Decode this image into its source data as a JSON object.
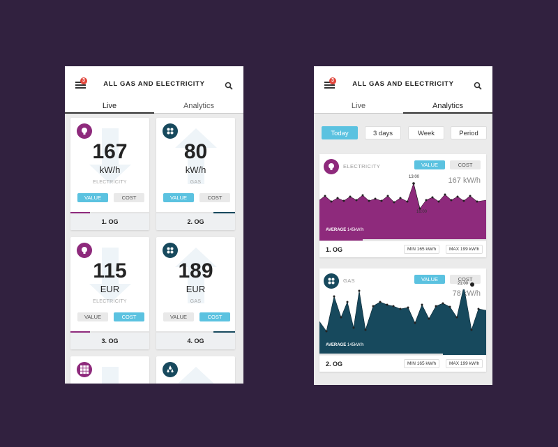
{
  "colors": {
    "background": "#31213f",
    "accent": "#5bc2e0",
    "electricity": "#8e2a7c",
    "gas": "#17495d",
    "badge": "#e0453b"
  },
  "header": {
    "title": "ALL GAS AND ELECTRICITY",
    "badge_count": "3"
  },
  "tabs": {
    "live": "Live",
    "analytics": "Analytics"
  },
  "live_cards": [
    {
      "icon": "lightbulb-icon",
      "value": "167",
      "unit": "kW/h",
      "type": "ELECTRICITY",
      "toggle_value": "VALUE",
      "toggle_cost": "COST",
      "selected": "VALUE",
      "label": "1. OG",
      "progress": 0.25
    },
    {
      "icon": "gas-burner-icon",
      "value": "80",
      "unit": "kW/h",
      "type": "GAS",
      "toggle_value": "VALUE",
      "toggle_cost": "COST",
      "selected": "VALUE",
      "label": "2. OG",
      "progress": 0.27
    },
    {
      "icon": "lightbulb-icon",
      "value": "115",
      "unit": "EUR",
      "type": "ELECTRICITY",
      "toggle_value": "VALUE",
      "toggle_cost": "COST",
      "selected": "COST",
      "label": "3. OG",
      "progress": 0.25
    },
    {
      "icon": "gas-burner-icon",
      "value": "189",
      "unit": "EUR",
      "type": "GAS",
      "toggle_value": "VALUE",
      "toggle_cost": "COST",
      "selected": "COST",
      "label": "4. OG",
      "progress": 0.27
    },
    {
      "icon": "grid-icon",
      "value": "",
      "unit": "",
      "type": "",
      "label": ""
    },
    {
      "icon": "water-drops-icon",
      "value": "",
      "unit": "",
      "type": "",
      "label": ""
    }
  ],
  "filters": [
    "Today",
    "3 days",
    "Week",
    "Period"
  ],
  "analytics_cards": [
    {
      "label": "ELECTRICITY",
      "icon": "lightbulb-icon",
      "toggle_value": "VALUE",
      "toggle_cost": "COST",
      "current": "167 kW/h",
      "peak_label": "13:00",
      "low_label": "16:00",
      "average_label": "AVERAGE",
      "average_value": "145kW/h",
      "floor": "1. OG",
      "min": "MIN 165 kW/h",
      "max": "MAX 199 kW/h",
      "progress": 0.26
    },
    {
      "label": "GAS",
      "icon": "gas-burner-icon",
      "toggle_value": "VALUE",
      "toggle_cost": "COST",
      "current": "78 kW/h",
      "peak_label": "21:00",
      "average_label": "AVERAGE",
      "average_value": "145kW/h",
      "floor": "2. OG",
      "min": "MIN 165 kW/h",
      "max": "MAX 199 kW/h",
      "progress": 0.26
    }
  ]
}
